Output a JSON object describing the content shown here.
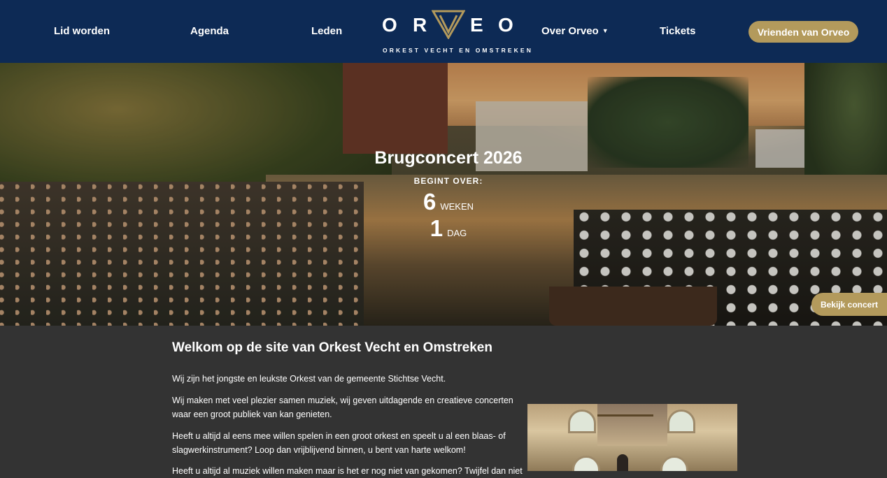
{
  "header": {
    "nav": {
      "lid_worden": "Lid worden",
      "agenda": "Agenda",
      "leden": "Leden",
      "over_orveo": "Over Orveo",
      "tickets": "Tickets"
    },
    "cta_label": "Vrienden van Orveo",
    "logo": {
      "letters": [
        "O",
        "R",
        "V",
        "E",
        "O"
      ],
      "subtitle": "ORKEST VECHT EN OMSTREKEN"
    }
  },
  "hero": {
    "title": "Brugconcert 2026",
    "begint_label": "BEGINT OVER:",
    "countdown": [
      {
        "value": "6",
        "unit": "WEKEN"
      },
      {
        "value": "1",
        "unit": "DAG"
      }
    ],
    "button_label": "Bekijk concert"
  },
  "main": {
    "title": "Welkom op de site van Orkest Vecht en Omstreken",
    "paragraphs": [
      "Wij zijn het jongste en leukste Orkest van de gemeente Stichtse Vecht.",
      "Wij maken met veel plezier samen muziek, wij geven uitdagende en creatieve concerten waar een groot publiek van kan genieten.",
      "Heeft u altijd al eens mee willen spelen in een groot orkest en speelt u al een blaas- of slagwerkinstrument? Loop dan vrijblijvend binnen, u bent van harte welkom!",
      "Heeft u altijd al muziek willen maken maar is het er nog niet van gekomen? Twijfel dan niet"
    ]
  },
  "colors": {
    "header_bg": "#0d2a55",
    "accent_gold": "#b39a5c",
    "page_bg": "#333333"
  },
  "icons": {
    "dropdown": "caret-down-icon",
    "logo_mark": "triangle-v-icon"
  }
}
